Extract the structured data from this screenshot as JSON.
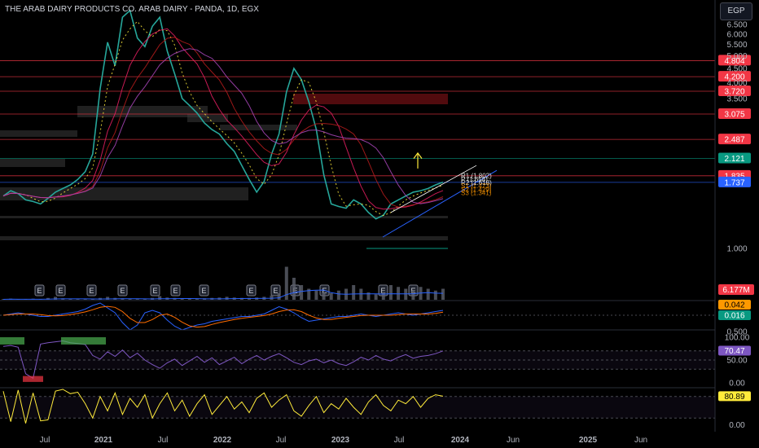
{
  "header": {
    "title": "THE ARAB DAIRY PRODUCTS CO. ARAB DAIRY - PANDA, 1D, EGX",
    "currency_button": "EGP"
  },
  "colors": {
    "background": "#000000",
    "price_tag_red": "#f23645",
    "price_tag_green": "#089981",
    "price_tag_blue": "#2962ff",
    "price_tag_orange": "#ff9800",
    "rsi_purple": "#7e57c2",
    "stoch_yellow": "#ffeb3b",
    "volume_ma_blue": "#2962ff",
    "resistance_line": "#f23645",
    "support_line": "#089981"
  },
  "chart_data": [
    {
      "type": "line",
      "name": "price-pane",
      "scale": "log",
      "x_labels": [
        "Jul",
        "2021",
        "Jul",
        "2022",
        "Jul",
        "2023",
        "Jul",
        "2024",
        "Jun",
        "2025",
        "Jun"
      ],
      "y_ticks": [
        "6.500",
        "6.000",
        "5.500",
        "5.000",
        "4.500",
        "4.000",
        "3.500",
        "1.000",
        "0.500"
      ],
      "ylim": [
        0.5,
        6.8
      ],
      "series": [
        {
          "values": [
            1.55,
            1.62,
            1.58,
            1.5,
            1.48,
            1.45,
            1.52,
            1.6,
            1.65,
            1.7,
            1.78,
            1.9,
            2.2,
            3.8,
            5.6,
            4.6,
            6.9,
            7.3,
            5.8,
            5.4,
            6.4,
            6.9,
            5.2,
            4.3,
            3.5,
            3.3,
            3.1,
            2.85,
            2.7,
            2.6,
            2.4,
            2.25,
            2.0,
            1.78,
            1.6,
            1.75,
            2.2,
            2.6,
            3.7,
            4.5,
            4.1,
            3.4,
            2.7,
            1.85,
            1.45,
            1.42,
            1.4,
            1.5,
            1.45,
            1.35,
            1.28,
            1.32,
            1.45,
            1.5,
            1.55,
            1.6,
            1.62,
            1.65,
            1.7,
            1.74
          ]
        }
      ],
      "horizontal_levels": [
        {
          "value": 4.804,
          "label": "4.804",
          "tag_color": "#f23645"
        },
        {
          "value": 4.2,
          "label": "4.200",
          "tag_color": "#f23645"
        },
        {
          "value": 3.72,
          "label": "3.720",
          "tag_color": "#f23645"
        },
        {
          "value": 3.075,
          "label": "3.075",
          "tag_color": "#f23645"
        },
        {
          "value": 2.487,
          "label": "2.487",
          "tag_color": "#f23645"
        },
        {
          "value": 2.121,
          "label": "2.121",
          "tag_color": "#089981"
        },
        {
          "value": 1.835,
          "label": "1.835",
          "tag_color": "#f23645"
        },
        {
          "value": 1.737,
          "label": "1.737",
          "tag_color": "#2962ff"
        }
      ],
      "pivot_labels": [
        "R1 (1.802)",
        "P (1.658)",
        "R2 (1.618)",
        "S1 (1.473)",
        "S2 (1.429)",
        "S3 (1.341)"
      ],
      "earnings_markers": [
        "E",
        "E",
        "E",
        "E",
        "E",
        "E",
        "E",
        "E",
        "E",
        "E",
        "E",
        "E",
        "E"
      ]
    },
    {
      "type": "bar",
      "name": "volume-pane",
      "last_value_label": "6.177M",
      "values": [
        0.02,
        0.03,
        0.02,
        0.02,
        0.03,
        0.02,
        0.05,
        0.08,
        0.04,
        0.03,
        0.02,
        0.02,
        0.03,
        0.05,
        0.08,
        0.05,
        0.04,
        0.03,
        0.02,
        0.03,
        0.05,
        0.1,
        0.06,
        0.05,
        0.04,
        0.03,
        0.03,
        0.04,
        0.05,
        0.06,
        0.08,
        0.06,
        0.05,
        0.05,
        0.06,
        0.08,
        0.12,
        0.18,
        0.9,
        0.6,
        0.4,
        0.3,
        0.25,
        0.2,
        0.18,
        0.25,
        0.3,
        0.4,
        0.3,
        0.2,
        0.15,
        0.2,
        0.4,
        0.35,
        0.3,
        0.25,
        0.35,
        0.3,
        0.25,
        0.3
      ]
    },
    {
      "type": "line",
      "name": "macd-pane",
      "labels": [
        "0.042",
        "0.016"
      ],
      "values": [
        0.0,
        0.01,
        0.02,
        0.01,
        0.0,
        -0.01,
        -0.01,
        0.0,
        0.01,
        0.02,
        0.03,
        0.05,
        0.08,
        0.1,
        0.06,
        0.02,
        -0.06,
        -0.12,
        -0.08,
        0.02,
        0.04,
        0.02,
        -0.04,
        -0.09,
        -0.12,
        -0.1,
        -0.08,
        -0.07,
        -0.05,
        -0.04,
        -0.03,
        -0.02,
        -0.01,
        -0.01,
        0.0,
        0.01,
        0.04,
        0.07,
        0.05,
        0.02,
        -0.02,
        -0.05,
        -0.04,
        -0.03,
        -0.02,
        -0.01,
        -0.01,
        0.0,
        0.01,
        0.0,
        -0.01,
        0.0,
        0.01,
        0.02,
        0.01,
        0.0,
        0.01,
        0.02,
        0.03,
        0.04
      ]
    },
    {
      "type": "line",
      "name": "rsi-pane",
      "y_ticks": [
        "100.00",
        "50.00",
        "0.00"
      ],
      "last_value_label": "70.47",
      "ylim": [
        0,
        100
      ],
      "values": [
        80,
        82,
        78,
        20,
        10,
        85,
        88,
        90,
        92,
        88,
        86,
        84,
        60,
        52,
        68,
        58,
        72,
        55,
        65,
        50,
        40,
        32,
        44,
        52,
        38,
        48,
        58,
        45,
        55,
        40,
        48,
        56,
        42,
        52,
        60,
        50,
        58,
        64,
        55,
        45,
        40,
        48,
        52,
        44,
        50,
        42,
        38,
        46,
        56,
        50,
        60,
        52,
        48,
        56,
        62,
        54,
        58,
        60,
        64,
        70
      ]
    },
    {
      "type": "line",
      "name": "stoch-rsi-pane",
      "y_ticks": [
        "0.00"
      ],
      "last_value_label": "80.89",
      "ylim": [
        0,
        100
      ],
      "values": [
        95,
        10,
        98,
        5,
        90,
        12,
        15,
        95,
        100,
        88,
        92,
        60,
        20,
        80,
        40,
        90,
        30,
        75,
        50,
        85,
        20,
        60,
        90,
        40,
        70,
        25,
        60,
        85,
        30,
        55,
        80,
        45,
        65,
        35,
        75,
        90,
        50,
        70,
        85,
        40,
        25,
        55,
        80,
        35,
        60,
        45,
        75,
        50,
        30,
        65,
        85,
        55,
        40,
        70,
        60,
        80,
        50,
        75,
        85,
        81
      ]
    }
  ]
}
